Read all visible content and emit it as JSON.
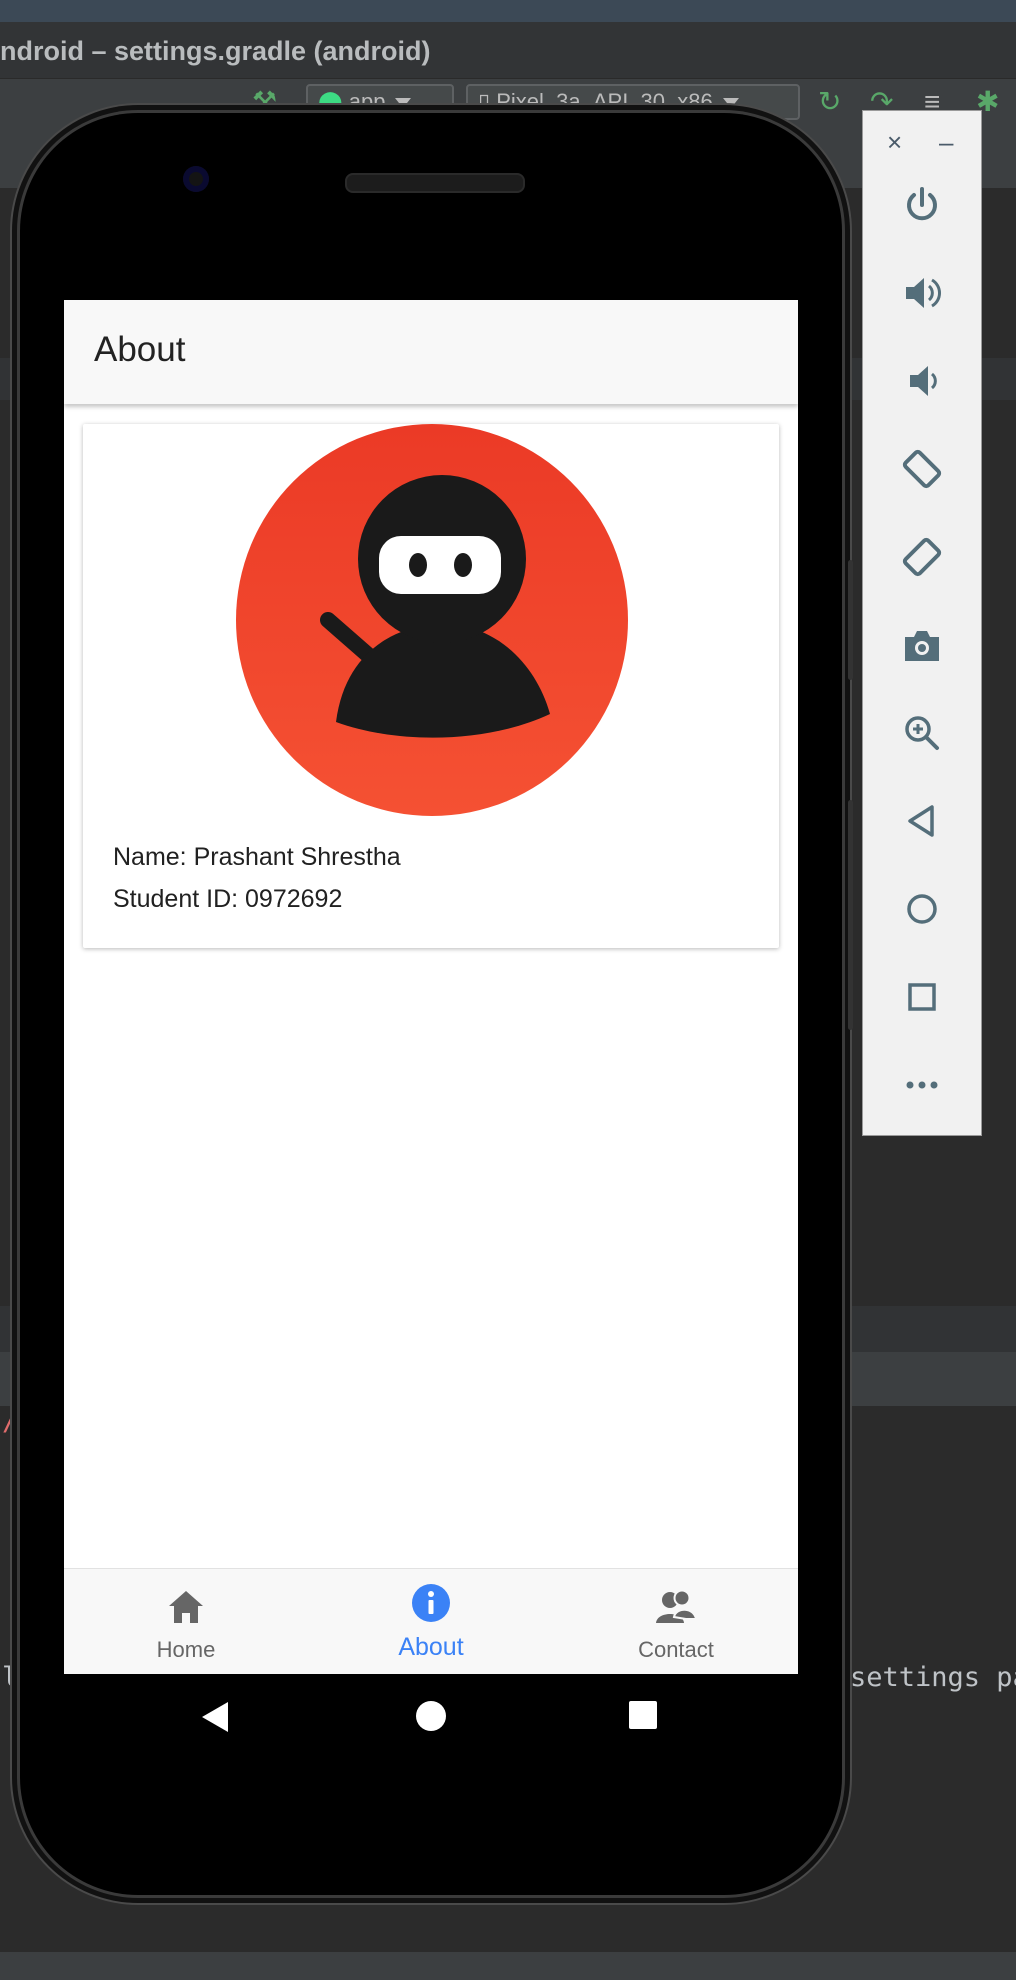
{
  "ide": {
    "window_title": "ndroid – settings.gradle (android)",
    "run_config": "app",
    "device_selector": "Pixel_3a_API_30_x86",
    "code_fragment_left_1": "/",
    "code_fragment_left_2": "l",
    "code_fragment_right": "settings pa"
  },
  "app": {
    "appbar_title": "About",
    "profile": {
      "name_line": "Name: Prashant Shrestha",
      "student_id_line": "Student ID: 0972692"
    },
    "bottom_nav": [
      {
        "label": "Home",
        "icon": "home-icon",
        "active": false
      },
      {
        "label": "About",
        "icon": "info-icon",
        "active": true
      },
      {
        "label": "Contact",
        "icon": "contacts-icon",
        "active": false
      }
    ],
    "colors": {
      "accent": "#3b82f6",
      "avatar_red": "#ef4430",
      "ninja_black": "#1a1a1a"
    }
  },
  "emulator_panel": {
    "close_glyph": "×",
    "minimize_glyph": "–",
    "controls": [
      "power-icon",
      "volume-up-icon",
      "volume-down-icon",
      "rotate-left-icon",
      "rotate-right-icon",
      "camera-icon",
      "zoom-icon",
      "back-icon",
      "home-circle-icon",
      "overview-icon",
      "more-icon"
    ]
  }
}
